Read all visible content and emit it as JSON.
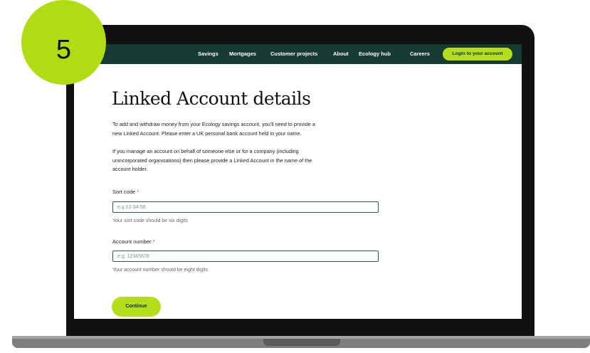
{
  "step": {
    "number": "5"
  },
  "nav": {
    "items": [
      "Savings",
      "Mortgages",
      "Customer projects",
      "About",
      "Ecology hub",
      "Careers"
    ],
    "login_label": "Login to your account"
  },
  "page": {
    "title": "Linked Account details",
    "para1_line1": "To add and withdraw money from your Ecology savings account, you'll need to provide a",
    "para1_line2": "new Linked Account. Please enter a UK personal bank account held in your name.",
    "para2_line1": "If you manage an account on behalf of someone else or for a company (including",
    "para2_line2": "unincorporated organisations) then please provide a Linked Account in the name of the",
    "para2_line3": "account holder."
  },
  "form": {
    "sort_code": {
      "label": "Sort code",
      "required_mark": "*",
      "placeholder": "e.g 12-34-56",
      "hint": "Your sort code should be six digits"
    },
    "account_number": {
      "label": "Account number",
      "required_mark": "*",
      "placeholder": "e.g. 12345678",
      "hint": "Your account number should be eight digits"
    },
    "continue_label": "Continue"
  },
  "colors": {
    "brand_green": "#b4dd1e",
    "nav_bg": "#153b33",
    "required": "#d0312d"
  }
}
